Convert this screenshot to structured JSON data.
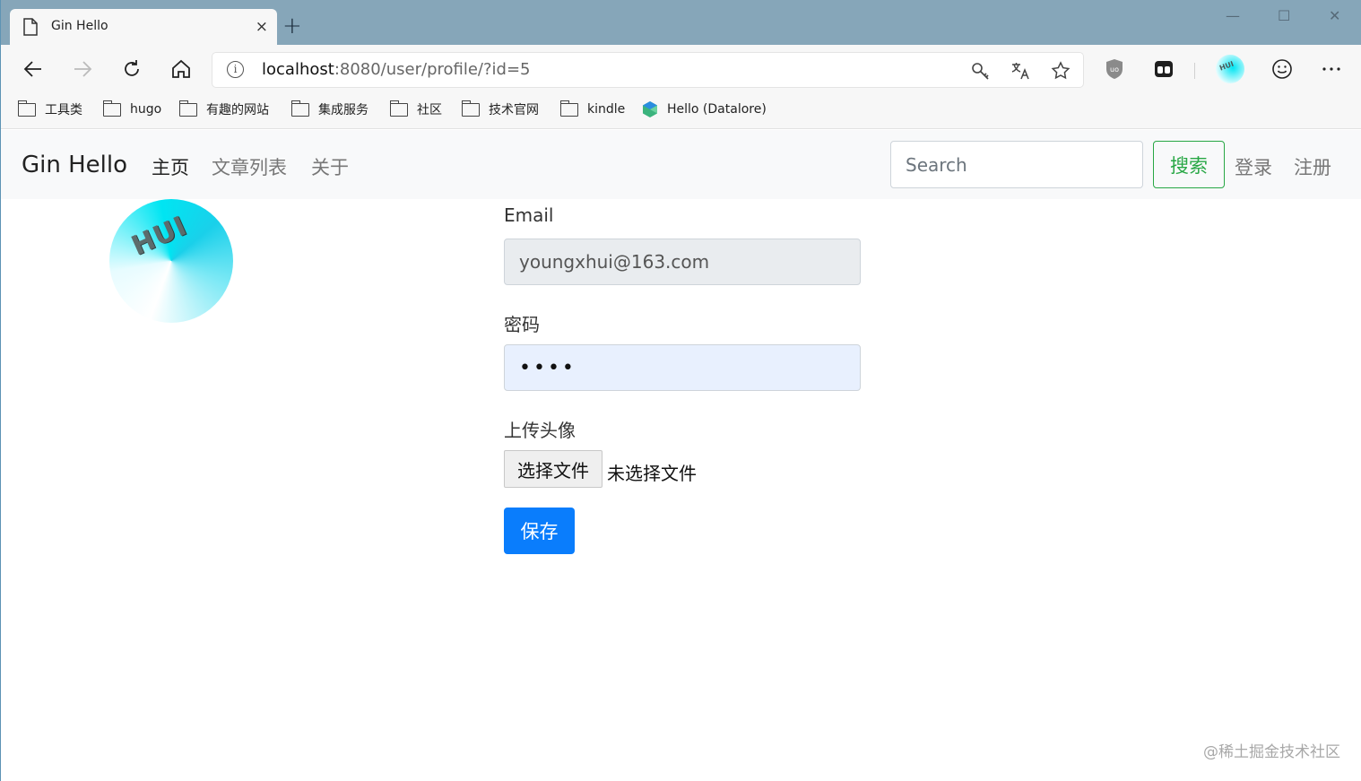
{
  "browser": {
    "tab_title": "Gin Hello",
    "new_tab": "+",
    "tab_close": "×",
    "window_controls": {
      "minimize": "—",
      "maximize": "☐",
      "close": "✕"
    },
    "url_host": "localhost",
    "url_path": ":8080/user/profile/?id=5",
    "bookmarks": [
      "工具类",
      "hugo",
      "有趣的网站",
      "集成服务",
      "社区",
      "技术官网",
      "kindle",
      "Hello (Datalore)"
    ]
  },
  "navbar": {
    "brand": "Gin Hello",
    "links": [
      "主页",
      "文章列表",
      "关于"
    ],
    "search_placeholder": "Search",
    "search_button": "搜索",
    "login": "登录",
    "register": "注册"
  },
  "avatar": {
    "text": "HUI"
  },
  "form": {
    "email_label": "Email",
    "email_value": "youngxhui@163.com",
    "password_label": "密码",
    "password_value": "••••",
    "avatar_label": "上传头像",
    "file_button": "选择文件",
    "file_status": "未选择文件",
    "save_button": "保存"
  },
  "watermark": "@稀土掘金技术社区"
}
